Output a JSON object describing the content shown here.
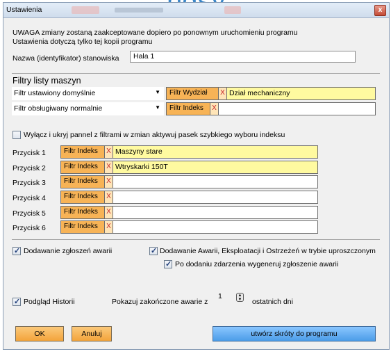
{
  "window": {
    "title": "Ustawienia",
    "close_glyph": "x"
  },
  "notice": {
    "line1": "UWAGA zmiany zostaną zaakceptowane dopiero po ponownym uruchomieniu programu",
    "line2": "Ustawienia dotyczą tylko tej kopii programu"
  },
  "station": {
    "label": "Nazwa (identyfikator) stanowiska",
    "value": "Hala 1"
  },
  "filters": {
    "section_title": "Filtry listy maszyn",
    "combo1": {
      "value": "Filtr ustawiony domyślnie"
    },
    "combo2": {
      "value": "Filtr obsługiwany normalnie"
    },
    "filter1": {
      "label": "Filtr Wydział",
      "x": "X",
      "value": "Dział mechaniczny"
    },
    "filter2": {
      "label": "Filtr Indeks",
      "x": "X",
      "value": ""
    },
    "hide_panel_label": "Wyłącz i ukryj pannel z filtrami w zmian aktywuj pasek szybkiego wyboru indeksu",
    "hide_panel_checked": false
  },
  "buttons_list": [
    {
      "label": "Przycisk 1",
      "filter": "Filtr Indeks",
      "x": "X",
      "value": "Maszyny stare"
    },
    {
      "label": "Przycisk 2",
      "filter": "Filtr Indeks",
      "x": "X",
      "value": "Wtryskarki 150T"
    },
    {
      "label": "Przycisk 3",
      "filter": "Filtr Indeks",
      "x": "X",
      "value": ""
    },
    {
      "label": "Przycisk 4",
      "filter": "Filtr Indeks",
      "x": "X",
      "value": ""
    },
    {
      "label": "Przycisk 5",
      "filter": "Filtr Indeks",
      "x": "X",
      "value": ""
    },
    {
      "label": "Przycisk 6",
      "filter": "Filtr Indeks",
      "x": "X",
      "value": ""
    }
  ],
  "options": {
    "add_reports": {
      "label": "Dodawanie zgłoszeń awarii",
      "checked": true
    },
    "simplified": {
      "label": "Dodawanie Awarii, Eksploatacji i Ostrzeżeń w trybie uproszczonym",
      "checked": true
    },
    "generate": {
      "label": "Po dodaniu zdarzenia wygeneruj zgłoszenie awarii",
      "checked": true
    },
    "history": {
      "label": "Podgląd Historii",
      "checked": true
    },
    "show_closed": {
      "label": "Pokazuj zakończone awarie z",
      "value": "1",
      "suffix": "ostatnich dni"
    }
  },
  "footer": {
    "ok": "OK",
    "cancel": "Anuluj",
    "shortcuts": "utwórz skróty do programu"
  },
  "colors": {
    "orange": "#f7b356",
    "yellow": "#fffaa0",
    "blue": "#5aa7f0",
    "x_red": "#c62020"
  }
}
